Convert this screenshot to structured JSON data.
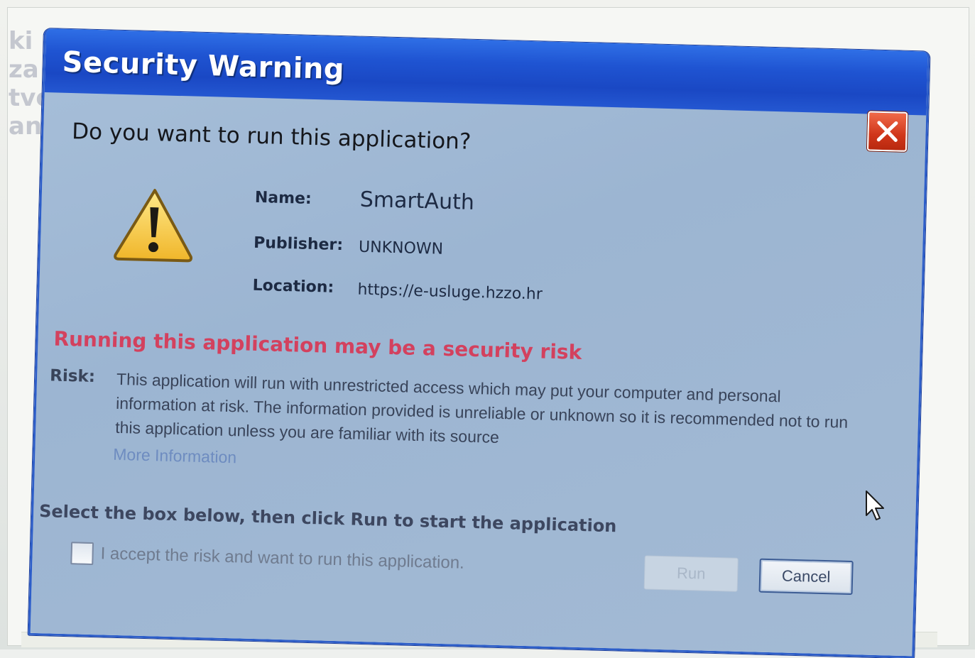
{
  "background": {
    "text_fragments": [
      "ki",
      "za",
      "tvo",
      "anj"
    ]
  },
  "dialog": {
    "title": "Security Warning",
    "heading": "Do you want to run this application?",
    "fields": {
      "name_label": "Name:",
      "name_value": "SmartAuth",
      "publisher_label": "Publisher:",
      "publisher_value": "UNKNOWN",
      "location_label": "Location:",
      "location_value": "https://e-usluge.hzzo.hr"
    },
    "risk_title": "Running this application may be a security risk",
    "risk_label": "Risk:",
    "risk_text": "This application will run with unrestricted access which may put your computer and personal information at risk. The information provided is unreliable or unknown so it is recommended not to run this application unless you are familiar with its source",
    "more_info": "More Information",
    "select_instruction": "Select the box below, then click Run to start the application",
    "accept_checkbox": {
      "label": "I accept the risk and want to run this application.",
      "checked": false
    },
    "buttons": {
      "run": "Run",
      "run_enabled": false,
      "cancel": "Cancel"
    }
  },
  "colors": {
    "titlebar": "#1f54d2",
    "risk_title": "#d3415e",
    "close_button": "#d0361a",
    "dialog_body": "#a7bfd9"
  },
  "icons": [
    "warning-icon",
    "close-icon",
    "mouse-cursor-icon"
  ]
}
